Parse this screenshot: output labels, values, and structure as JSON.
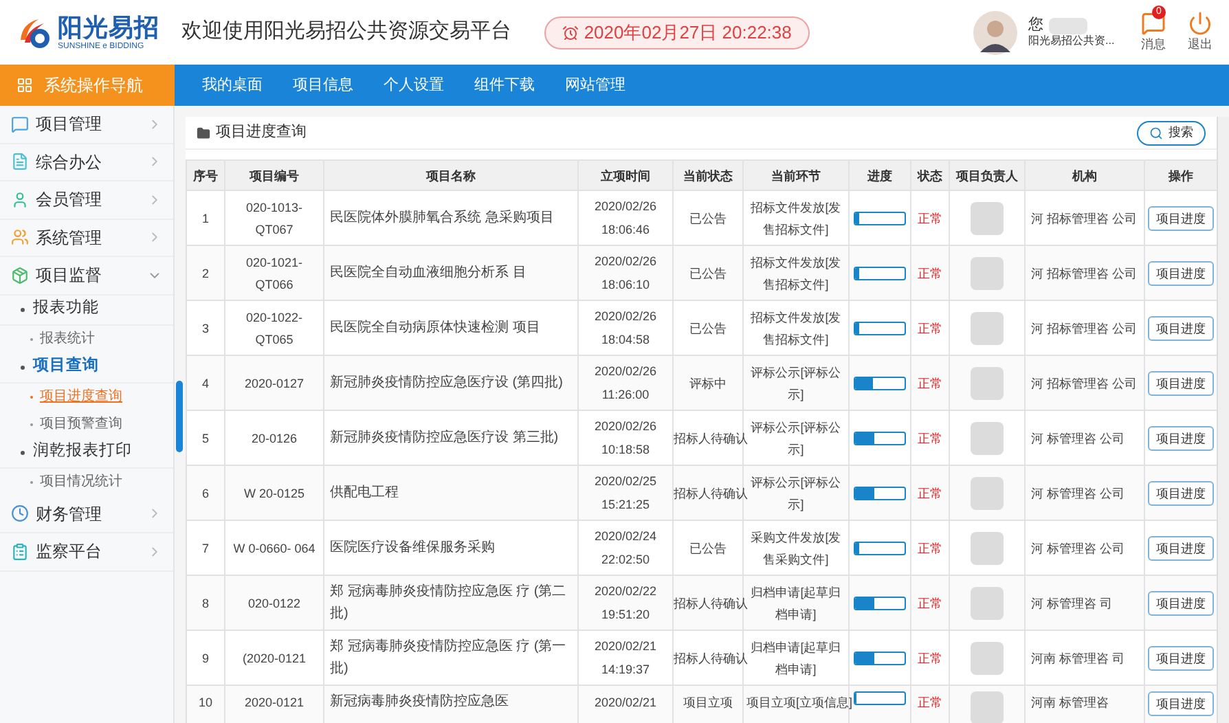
{
  "header": {
    "logo_name": "阳光易招",
    "logo_sub": "SUNSHINE e BIDDING",
    "title": "欢迎使用阳光易招公共资源交易平台",
    "datetime": "2020年02月27日 20:22:38",
    "user_greeting": "您",
    "user_org": "阳光易招公共资...",
    "messages": {
      "label": "消息",
      "badge": "0"
    },
    "logout": "退出"
  },
  "nav": {
    "title": "系统操作导航",
    "items": [
      "我的桌面",
      "项目信息",
      "个人设置",
      "组件下载",
      "网站管理"
    ]
  },
  "sidebar": {
    "items": [
      {
        "label": "项目管理",
        "color": "#4aa3df",
        "expanded": false
      },
      {
        "label": "综合办公",
        "color": "#4ac0d8",
        "expanded": false
      },
      {
        "label": "会员管理",
        "color": "#2fbf8f",
        "expanded": false
      },
      {
        "label": "系统管理",
        "color": "#f0a030",
        "expanded": false
      },
      {
        "label": "项目监督",
        "color": "#4cbb6c",
        "expanded": true,
        "children": [
          {
            "label": "报表功能",
            "children": [
              {
                "label": "报表统计",
                "selected": false
              }
            ]
          },
          {
            "label": "项目查询",
            "children": [
              {
                "label": "项目进度查询",
                "selected": true
              },
              {
                "label": "项目预警查询",
                "selected": false
              }
            ]
          },
          {
            "label": "润乾报表打印",
            "children": [
              {
                "label": "项目情况统计",
                "selected": false
              }
            ]
          }
        ]
      },
      {
        "label": "财务管理",
        "color": "#4a90d9",
        "expanded": false
      },
      {
        "label": "监察平台",
        "color": "#2bb3c0",
        "expanded": false
      }
    ]
  },
  "panel": {
    "title": "项目进度查询",
    "search_button": "搜索"
  },
  "table": {
    "columns": [
      "序号",
      "项目编号",
      "项目名称",
      "立项时间",
      "当前状态",
      "当前环节",
      "进度",
      "状态",
      "项目负责人",
      "机构",
      "操作"
    ],
    "rows": [
      {
        "no": "1",
        "code": "020-1013-QT067",
        "name": "民医院体外膜肺氧合系统 急采购项目",
        "date": "2020/02/26",
        "time": "18:06:46",
        "status": "已公告",
        "stage": "招标文件发放[发售招标文件]",
        "level": 0.08,
        "state": "正常",
        "agency": "河 招标管理咨 公司",
        "action": "项目进度"
      },
      {
        "no": "2",
        "code": "020-1021-QT066",
        "name": "民医院全自动血液细胞分析系 目",
        "date": "2020/02/26",
        "time": "18:06:10",
        "status": "已公告",
        "stage": "招标文件发放[发售招标文件]",
        "level": 0.08,
        "state": "正常",
        "agency": "河 招标管理咨 公司",
        "action": "项目进度"
      },
      {
        "no": "3",
        "code": "020-1022-QT065",
        "name": "民医院全自动病原体快速检测 项目",
        "date": "2020/02/26",
        "time": "18:04:58",
        "status": "已公告",
        "stage": "招标文件发放[发售招标文件]",
        "level": 0.08,
        "state": "正常",
        "agency": "河 招标管理咨 公司",
        "action": "项目进度"
      },
      {
        "no": "4",
        "code": "2020-0127",
        "name": "新冠肺炎疫情防控应急医疗设 (第四批)",
        "date": "2020/02/26",
        "time": "11:26:00",
        "status": "评标中",
        "stage": "评标公示[评标公示]",
        "level": 0.35,
        "state": "正常",
        "agency": "河 招标管理咨 公司",
        "action": "项目进度"
      },
      {
        "no": "5",
        "code": "20-0126",
        "name": "新冠肺炎疫情防控应急医疗设 第三批)",
        "date": "2020/02/26",
        "time": "10:18:58",
        "status": "招标人待确认",
        "stage": "评标公示[评标公示]",
        "level": 0.4,
        "state": "正常",
        "agency": "河 标管理咨 公司",
        "action": "项目进度"
      },
      {
        "no": "6",
        "code": "W 20-0125",
        "name": "供配电工程",
        "date": "2020/02/25",
        "time": "15:21:25",
        "status": "招标人待确认",
        "stage": "评标公示[评标公示]",
        "level": 0.4,
        "state": "正常",
        "agency": "河 标管理咨 公司",
        "action": "项目进度"
      },
      {
        "no": "7",
        "code": "W 0-0660- 064",
        "name": "医院医疗设备维保服务采购",
        "date": "2020/02/24",
        "time": "22:02:50",
        "status": "已公告",
        "stage": "采购文件发放[发售采购文件]",
        "level": 0.08,
        "state": "正常",
        "agency": "河 标管理咨 公司",
        "action": "项目进度"
      },
      {
        "no": "8",
        "code": "020-0122",
        "name": "郑 冠病毒肺炎疫情防控应急医 疗 (第二批)",
        "date": "2020/02/22",
        "time": "19:51:20",
        "status": "招标人待确认",
        "stage": "归档申请[起草归档申请]",
        "level": 0.4,
        "state": "正常",
        "agency": "河 标管理咨 司",
        "action": "项目进度"
      },
      {
        "no": "9",
        "code": "(2020-0121",
        "name": "郑 冠病毒肺炎疫情防控应急医 疗 (第一批)",
        "date": "2020/02/21",
        "time": "14:19:37",
        "status": "招标人待确认",
        "stage": "归档申请[起草归档申请]",
        "level": 0.4,
        "state": "正常",
        "agency": "河南 标管理咨 司",
        "action": "项目进度"
      },
      {
        "no": "10",
        "code": "2020-0121",
        "name": "新冠病毒肺炎疫情防控应急医",
        "date": "2020/02/21",
        "status": "项目立项",
        "stage": "项目立项[立项信息]",
        "level": 0.03,
        "state": "正常",
        "agency": "河南 标管理咨",
        "action": "项目进度"
      }
    ]
  }
}
